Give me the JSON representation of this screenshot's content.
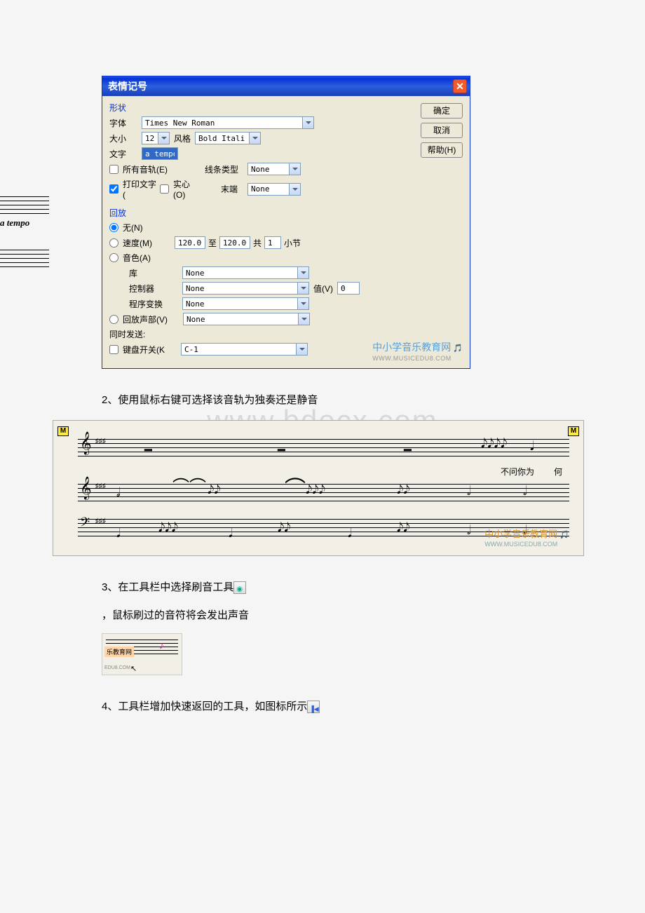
{
  "dialog": {
    "title": "表情记号",
    "ok": "确定",
    "cancel": "取消",
    "help": "帮助(H)",
    "shape_section": "形状",
    "font_label": "字体",
    "font_value": "Times New Roman",
    "size_label": "大小",
    "size_value": "12",
    "style_label": "风格",
    "style_value": "Bold Itali",
    "text_label": "文字",
    "text_value": "a tempo",
    "all_tracks": "所有音轨(E)",
    "print_text": "打印文字(",
    "solid": "实心(O)",
    "line_type_label": "线条类型",
    "line_type_value": "None",
    "end_label": "末端",
    "end_value": "None",
    "playback_section": "回放",
    "none_radio": "无(N)",
    "tempo_radio": "速度(M)",
    "tempo_from": "120.00",
    "tempo_to_label": "至",
    "tempo_to": "120.00",
    "tempo_total_label": "共",
    "tempo_total": "1",
    "tempo_bars": "小节",
    "patch_radio": "音色(A)",
    "bank_label": "库",
    "bank_value": "None",
    "controller_label": "控制器",
    "controller_value": "None",
    "value_label": "值(V)",
    "value_value": "0",
    "program_label": "程序变换",
    "program_value": "None",
    "voice_radio": "回放声部(V)",
    "voice_value": "None",
    "send_label": "同时发送:",
    "keyswitch": "键盘开关(K",
    "keyswitch_value": "C-1"
  },
  "text": {
    "item2": "2、使用鼠标右键可选择该音轨为独奏还是静音",
    "item3a": "3、在工具栏中选择刷音工具",
    "item3b": "，鼠标刷过的音符将会发出声音",
    "item4": "4、工具栏增加快速返回的工具，如图标所示",
    "bg_watermark": "www.bdocx.com"
  },
  "score": {
    "m_badge": "M",
    "lyric1": "不问你为",
    "lyric2": "何",
    "watermark_cn": "中小学音乐教育网",
    "watermark_url": "WWW.MUSICEDU8.COM"
  },
  "left_fragment": {
    "tempo_marking": "a tempo"
  },
  "mini": {
    "badge": "乐教育网",
    "url_frag": "EDU8.COM"
  }
}
